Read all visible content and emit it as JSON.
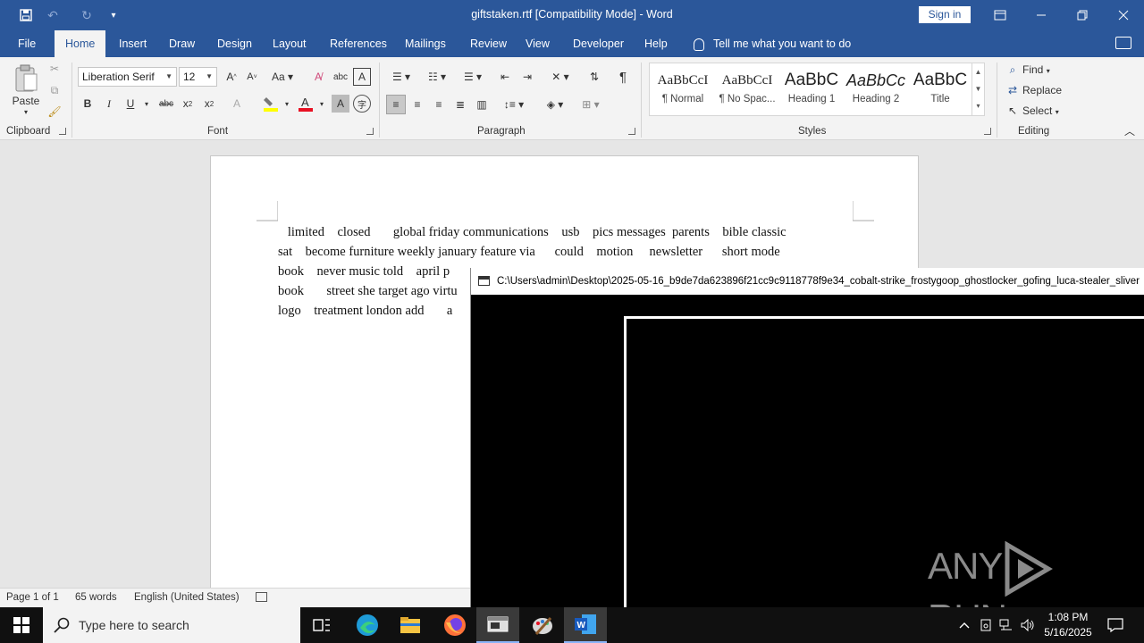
{
  "window": {
    "title": "giftstaken.rtf [Compatibility Mode]  -  Word",
    "sign_in": "Sign in"
  },
  "tabs": [
    "File",
    "Home",
    "Insert",
    "Draw",
    "Design",
    "Layout",
    "References",
    "Mailings",
    "Review",
    "View",
    "Developer",
    "Help"
  ],
  "tell_me": "Tell me what you want to do",
  "clipboard": {
    "paste": "Paste",
    "label": "Clipboard"
  },
  "font": {
    "name": "Liberation Serif",
    "size": "12",
    "label": "Font"
  },
  "paragraph": {
    "label": "Paragraph"
  },
  "styles": {
    "label": "Styles",
    "items": [
      {
        "sample": "AaBbCcI",
        "name": "¶ Normal"
      },
      {
        "sample": "AaBbCcI",
        "name": "¶ No Spac..."
      },
      {
        "sample": "AaBbC",
        "name": "Heading 1"
      },
      {
        "sample": "AaBbCc",
        "name": "Heading 2"
      },
      {
        "sample": "AaBbC",
        "name": "Title"
      }
    ]
  },
  "editing": {
    "find": "Find",
    "replace": "Replace",
    "select": "Select",
    "label": "Editing"
  },
  "document": {
    "lines": [
      "   limited    closed       global friday communications    usb    pics messages  parents    bible classic",
      "sat    become furniture weekly january feature via      could    motion     newsletter      short mode",
      "book    never music told    april p",
      "book       street she target ago virtu",
      "logo    treatment london add       a"
    ]
  },
  "status": {
    "page": "Page 1 of 1",
    "words": "65 words",
    "language": "English (United States)"
  },
  "console": {
    "title": "C:\\Users\\admin\\Desktop\\2025-05-16_b9de7da623896f21cc9c9118778f9e34_cobalt-strike_frostygoop_ghostlocker_gofing_luca-stealer_sliver"
  },
  "watermark": {
    "left": "ANY",
    "right": "RUN"
  },
  "taskbar": {
    "search_placeholder": "Type here to search",
    "time": "1:08 PM",
    "date": "5/16/2025"
  },
  "colors": {
    "word_blue": "#2b579a",
    "ribbon_bg": "#f3f3f3",
    "taskbar_bg": "#101010"
  }
}
